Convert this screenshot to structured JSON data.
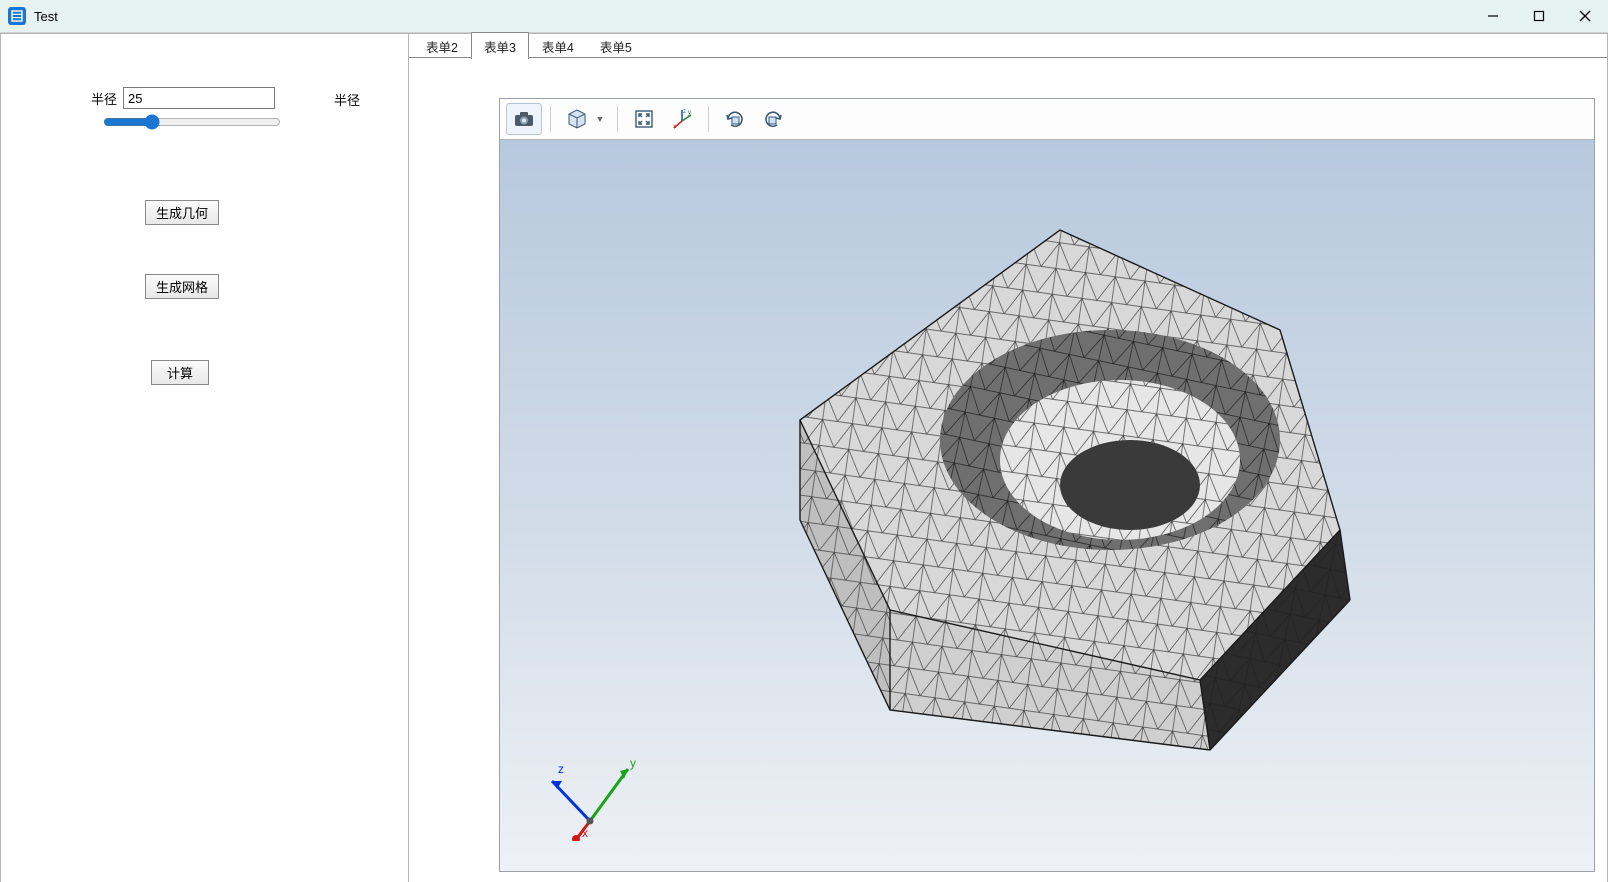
{
  "window": {
    "title": "Test"
  },
  "sidebar": {
    "param_label": "半径",
    "param_value": "25",
    "right_label": "半径",
    "slider_value": 25,
    "slider_min": 0,
    "slider_max": 100,
    "btn_geom": "生成几何",
    "btn_mesh": "生成网格",
    "btn_calc": "计算"
  },
  "tabs": {
    "items": [
      "表单2",
      "表单3",
      "表单4",
      "表单5"
    ],
    "active_index": 1
  },
  "viewer_toolbar": {
    "icons": [
      {
        "name": "camera-icon"
      },
      {
        "name": "view-cube-icon",
        "has_dropdown": true
      },
      {
        "name": "fit-to-window-icon"
      },
      {
        "name": "axis-orientation-icon"
      },
      {
        "name": "rotate-cw-icon"
      },
      {
        "name": "rotate-ccw-icon"
      }
    ]
  },
  "axis_labels": {
    "x": "x",
    "y": "y",
    "z": "z"
  }
}
